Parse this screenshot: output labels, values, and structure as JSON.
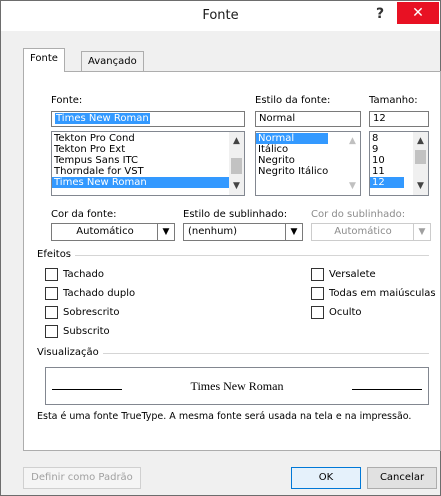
{
  "window": {
    "title": "Fonte",
    "ghost_title": "",
    "help_label": "?",
    "close_label": "✕"
  },
  "tabs": [
    {
      "label": "Fonte"
    },
    {
      "label": "Avançado"
    }
  ],
  "font": {
    "label": "Fonte:",
    "value": "Times New Roman",
    "items": [
      "Tekton Pro Cond",
      "Tekton Pro Ext",
      "Tempus Sans ITC",
      "Thorndale for VST",
      "Times New Roman"
    ],
    "selected_index": 4
  },
  "style": {
    "label": "Estilo da fonte:",
    "value": "Normal",
    "items": [
      "Normal",
      "Itálico",
      "Negrito",
      "Negrito Itálico"
    ],
    "selected_index": 0
  },
  "size": {
    "label": "Tamanho:",
    "value": "12",
    "items": [
      "8",
      "9",
      "10",
      "11",
      "12"
    ],
    "selected_index": 4
  },
  "font_color": {
    "label": "Cor da fonte:",
    "value": "Automático"
  },
  "underline_style": {
    "label": "Estilo de sublinhado:",
    "value": "(nenhum)"
  },
  "underline_color": {
    "label": "Cor do sublinhado:",
    "value": "Automático"
  },
  "effects": {
    "title": "Efeitos",
    "left": [
      "Tachado",
      "Tachado duplo",
      "Sobrescrito",
      "Subscrito"
    ],
    "right": [
      "Versalete",
      "Todas em maiúsculas",
      "Oculto"
    ]
  },
  "preview": {
    "title": "Visualização",
    "sample": "Times New Roman",
    "note": "Esta é uma fonte TrueType. A mesma fonte será usada na tela e na impressão."
  },
  "buttons": {
    "set_default": "Definir como Padrão",
    "ok": "OK",
    "cancel": "Cancelar"
  },
  "scroll_arrows": {
    "up": "▲",
    "down": "▼",
    "dropdown": "▼"
  }
}
